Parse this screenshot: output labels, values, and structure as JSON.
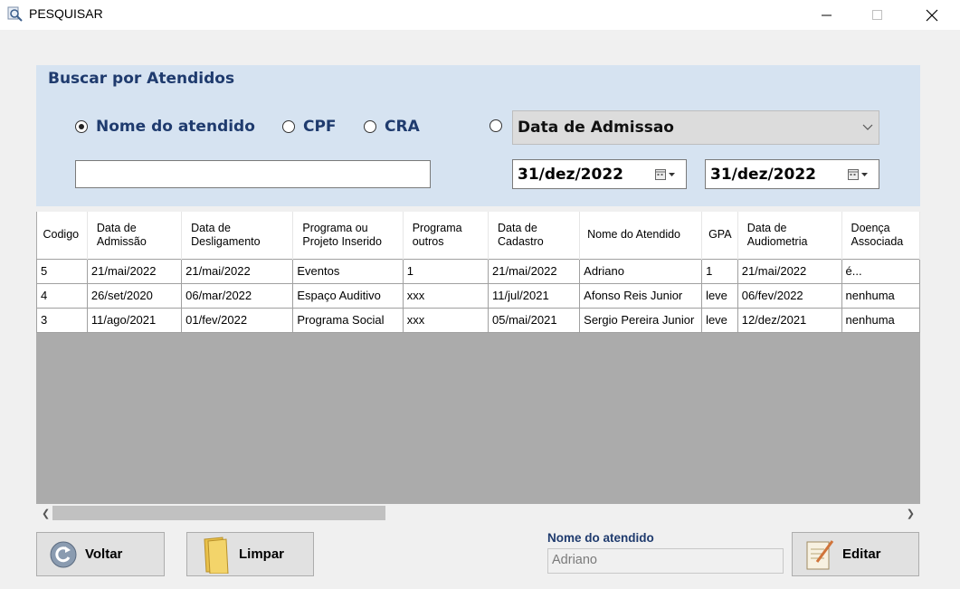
{
  "window": {
    "title": "PESQUISAR"
  },
  "search": {
    "heading": "Buscar por Atendidos",
    "radios": {
      "nome": "Nome do atendido",
      "cpf": "CPF",
      "cra": "CRA"
    },
    "selected_radio": "nome",
    "name_input_value": "",
    "date_field": "Data de Admissao",
    "date_from": "31/dez/2022",
    "date_to": "31/dez/2022"
  },
  "grid": {
    "headers": {
      "codigo": "Codigo",
      "admissao_1": "Data de",
      "admissao_2": "Admissão",
      "deslig_1": "Data de",
      "deslig_2": "Desligamento",
      "programa_1": "Programa ou",
      "programa_2": "Projeto Inserido",
      "outros_1": "Programa",
      "outros_2": "outros",
      "cadastro_1": "Data de",
      "cadastro_2": "Cadastro",
      "nome": "Nome do Atendido",
      "gpa": "GPA",
      "audio_1": "Data de",
      "audio_2": "Audiometria",
      "doenca_1": "Doença",
      "doenca_2": "Associada"
    },
    "rows": [
      {
        "codigo": "5",
        "admissao": "21/mai/2022",
        "desligamento": "21/mai/2022",
        "programa": "Eventos",
        "outros": "1",
        "cadastro": "21/mai/2022",
        "nome": "Adriano",
        "gpa": "1",
        "audiometria": "21/mai/2022",
        "doenca": "é..."
      },
      {
        "codigo": "4",
        "admissao": "26/set/2020",
        "desligamento": "06/mar/2022",
        "programa": "Espaço Auditivo",
        "outros": "xxx",
        "cadastro": "11/jul/2021",
        "nome": "Afonso Reis Junior",
        "gpa": "leve",
        "audiometria": "06/fev/2022",
        "doenca": "nenhuma"
      },
      {
        "codigo": "3",
        "admissao": "11/ago/2021",
        "desligamento": "01/fev/2022",
        "programa": "Programa Social",
        "outros": "xxx",
        "cadastro": "05/mai/2021",
        "nome": "Sergio Pereira Junior",
        "gpa": "leve",
        "audiometria": "12/dez/2021",
        "doenca": "nenhuma"
      }
    ]
  },
  "footer": {
    "voltar": "Voltar",
    "limpar": "Limpar",
    "editar": "Editar",
    "nome_label": "Nome do atendido",
    "nome_value": "Adriano"
  }
}
